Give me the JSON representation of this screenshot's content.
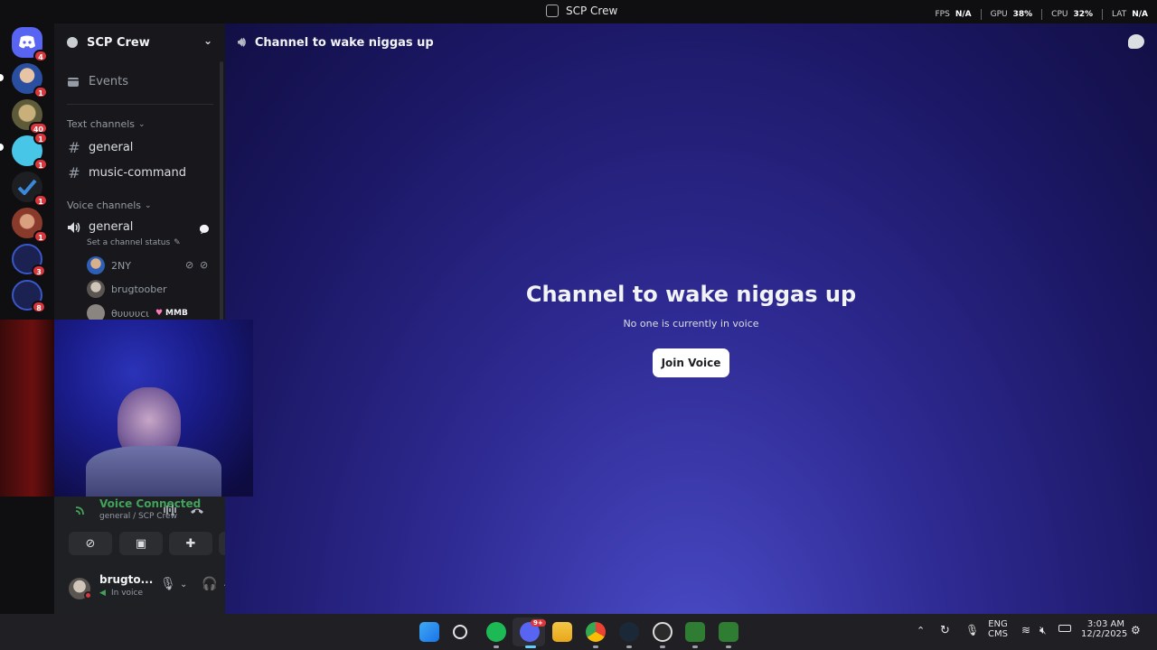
{
  "titlebar": {
    "title": "SCP Crew",
    "fps_label": "FPS",
    "fps_value": "N/A",
    "gpu_label": "GPU",
    "gpu_value": "38%",
    "cpu_label": "CPU",
    "cpu_value": "32%",
    "lat_label": "LAT",
    "lat_value": "N/A"
  },
  "servers": [
    {
      "name": "home",
      "badge": "4"
    },
    {
      "name": "server-1",
      "badge": "1"
    },
    {
      "name": "server-2",
      "badge": "40"
    },
    {
      "name": "server-3",
      "badge": "1",
      "top_badge": "1"
    },
    {
      "name": "server-4",
      "badge": "1"
    },
    {
      "name": "server-5",
      "badge": "1"
    },
    {
      "name": "server-6",
      "badge": "3"
    },
    {
      "name": "server-7",
      "badge": "8"
    }
  ],
  "sidebar": {
    "guild_name": "SCP Crew",
    "events_label": "Events",
    "text_category": "Text channels",
    "text_channels": [
      "general",
      "music-command"
    ],
    "voice_category": "Voice channels",
    "voice_channel": "general",
    "channel_status": "Set a channel status",
    "voice_users": [
      "2NY",
      "brugtoober",
      "θυυυυϲι"
    ],
    "user_tag": "MMB"
  },
  "voice_panel": {
    "title": "Voice Connected",
    "subtitle": "general / SCP Crew"
  },
  "user_panel": {
    "name": "brugto...",
    "status": "In voice"
  },
  "main": {
    "channel_title": "Channel to wake niggas up",
    "headline": "Channel to wake niggas up",
    "subtext": "No one is currently in voice",
    "join_label": "Join Voice"
  },
  "taskbar": {
    "lang_top": "ENG",
    "lang_bottom": "CMS",
    "time": "3:03 AM",
    "date": "12/2/2025",
    "discord_badge": "9+"
  }
}
